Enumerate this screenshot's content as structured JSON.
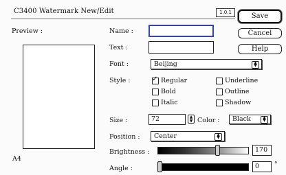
{
  "window": {
    "title": "C3400  Watermark New/Edit",
    "version": "1.0.1"
  },
  "buttons": {
    "save": "Save",
    "cancel": "Cancel",
    "help": "Help"
  },
  "preview": {
    "label": "Preview :",
    "paper_size": "A4"
  },
  "fields": {
    "name_label": "Name :",
    "name_value": "",
    "text_label": "Text :",
    "text_value": "",
    "font_label": "Font :",
    "font_value": "Beijing",
    "style_label": "Style :",
    "size_label": "Size :",
    "size_value": "72",
    "color_label": "Color :",
    "color_value": "Black",
    "position_label": "Position :",
    "position_value": "Center",
    "brightness_label": "Brightness :",
    "brightness_value": "170",
    "angle_label": "Angle :",
    "angle_value": "0",
    "angle_unit": "°"
  },
  "styles": [
    {
      "label": "Regular",
      "checked": true
    },
    {
      "label": "Underline",
      "checked": false
    },
    {
      "label": "Bold",
      "checked": false
    },
    {
      "label": "Outline",
      "checked": false
    },
    {
      "label": "Italic",
      "checked": false
    },
    {
      "label": "Shadow",
      "checked": false
    }
  ],
  "sliders": {
    "brightness_level": 170,
    "brightness_max": 255,
    "angle_level": 0
  }
}
